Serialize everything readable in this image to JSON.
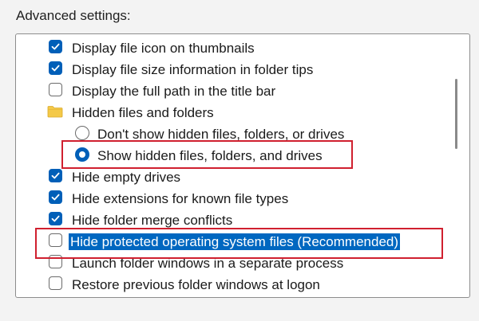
{
  "window": {
    "group_label": "Advanced settings:"
  },
  "settings": {
    "items": [
      {
        "kind": "checkbox",
        "checked": true,
        "label": "Display file icon on thumbnails"
      },
      {
        "kind": "checkbox",
        "checked": true,
        "label": "Display file size information in folder tips"
      },
      {
        "kind": "checkbox",
        "checked": false,
        "label": "Display the full path in the title bar"
      },
      {
        "kind": "folder",
        "icon": "folder-icon",
        "label": "Hidden files and folders"
      },
      {
        "kind": "radio",
        "checked": false,
        "label": "Don't show hidden files, folders, or drives"
      },
      {
        "kind": "radio",
        "checked": true,
        "label": "Show hidden files, folders, and drives"
      },
      {
        "kind": "checkbox",
        "checked": true,
        "label": "Hide empty drives"
      },
      {
        "kind": "checkbox",
        "checked": true,
        "label": "Hide extensions for known file types"
      },
      {
        "kind": "checkbox",
        "checked": true,
        "label": "Hide folder merge conflicts"
      },
      {
        "kind": "checkbox",
        "checked": false,
        "selected": true,
        "label": "Hide protected operating system files (Recommended)"
      },
      {
        "kind": "checkbox",
        "checked": false,
        "label": "Launch folder windows in a separate process"
      },
      {
        "kind": "checkbox",
        "checked": false,
        "label": "Restore previous folder windows at logon"
      }
    ]
  },
  "colors": {
    "accent": "#005fb8",
    "selection": "#0067c0",
    "annotation_red": "#d0202f",
    "folder_yellow": "#f4c948"
  }
}
